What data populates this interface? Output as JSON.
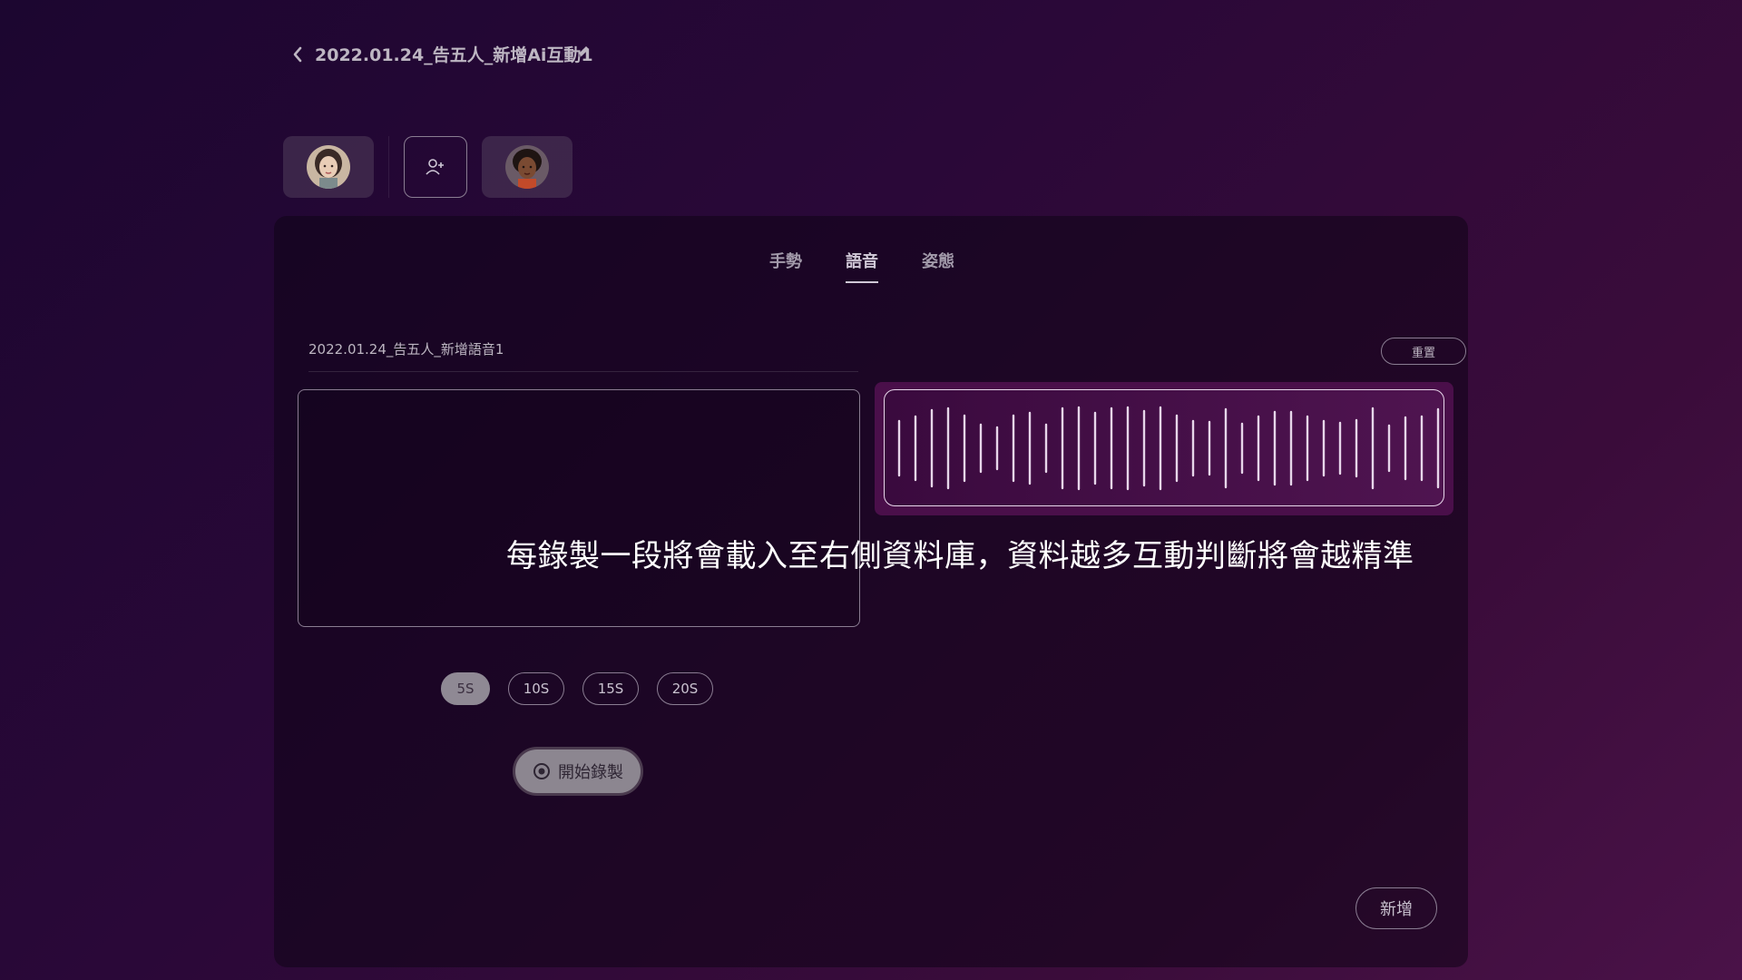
{
  "header": {
    "title": "2022.01.24_告五人_新增Ai互動1"
  },
  "characters": {
    "icons": [
      "avatar-woman-1",
      "add-user-icon",
      "avatar-woman-2"
    ]
  },
  "tabs": [
    {
      "label": "手勢",
      "active": false
    },
    {
      "label": "語音",
      "active": true
    },
    {
      "label": "姿態",
      "active": false
    }
  ],
  "recording": {
    "name": "2022.01.24_告五人_新增語音1",
    "reset_label": "重置",
    "durations": [
      "5S",
      "10S",
      "15S",
      "20S"
    ],
    "selected_duration": "5S",
    "start_label": "開始錄製",
    "add_label": "新增"
  },
  "hint": "每錄製一段將會載入至右側資料庫，資料越多互動判斷將會越精準",
  "colors": {
    "accent": "#4a0f4a",
    "waveform": "#e7d6ea"
  }
}
